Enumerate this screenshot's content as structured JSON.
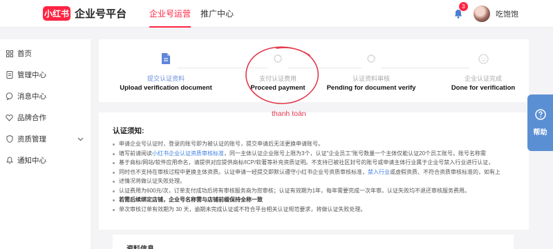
{
  "brand": {
    "logo_text": "小红书",
    "title": "企业号平台"
  },
  "topnav": {
    "tabs": [
      {
        "label": "企业号运营"
      },
      {
        "label": "推广中心"
      }
    ]
  },
  "user": {
    "notification_count": "3",
    "name": "吃饱饱"
  },
  "sidebar": {
    "items": [
      {
        "label": "首页",
        "icon": "grid-icon"
      },
      {
        "label": "管理中心",
        "icon": "document-icon"
      },
      {
        "label": "消息中心",
        "icon": "message-icon"
      },
      {
        "label": "品牌合作",
        "icon": "heart-icon"
      },
      {
        "label": "资质管理",
        "icon": "shield-icon"
      },
      {
        "label": "通知中心",
        "icon": "bell-icon"
      }
    ]
  },
  "steps": [
    {
      "cn": "提交认证资料",
      "en": "Upload verification document"
    },
    {
      "cn": "支付认证费用",
      "en": "Proceed payment"
    },
    {
      "cn": "认证资料审核",
      "en": "Pending for document verify"
    },
    {
      "cn": "企业认证完成",
      "en": "Done for verification"
    }
  ],
  "annotation": {
    "text": "thanh toán"
  },
  "notice": {
    "title": "认证须知:",
    "items": [
      {
        "text": "申请企业号认证时，登录的账号即为被认证的账号，提交申请后无法更换申请账号。"
      },
      {
        "pre": "填写前请阅读",
        "link": "小红书企业认证资质审核标准",
        "post": "，同一主体认证企业账号上限为3个，认证\"企业员工\"账号数量一个主体仅能认证20个员工账号。账号名称需"
      },
      {
        "text": "基于商标/网站/软件应用命名，请提供对应提供商标/ICP/软著等补充资质证明。不支持已被社区封号的账号或申请主体行业属于企业号禁入行业进行认证，"
      },
      {
        "pre": "同时也不支持在审核过程中更换主体资质。认证申请一经提交即默认遵守小红书企业号资质审核标准，",
        "link": "禁入行业",
        "post": "或虚假资质、不符合资质审核标准的，如有上"
      },
      {
        "text": "述情况将做认证失败处理。"
      },
      {
        "text": "认证费用为600元/次，订单支付成功后将有审核服务商为您审核；认证有效期为1年，每年需要完成一次年审。认证失败均不退还审核服务费用。"
      },
      {
        "text": "若需后续绑定店铺，企业号名称需与店铺前缀保持全称一致",
        "bold": true
      },
      {
        "text": "单次审核订单有效期为 30 天，逾期未完成认证或不符合平台相关认证规范要求，将做认证失败处理。"
      }
    ]
  },
  "info_card": {
    "title": "资料信息"
  },
  "help": {
    "label": "帮助"
  },
  "colors": {
    "brand": "#ff2442",
    "accent": "#5b8fd4",
    "link": "#3d7fe0",
    "annotation": "#e2394c"
  }
}
